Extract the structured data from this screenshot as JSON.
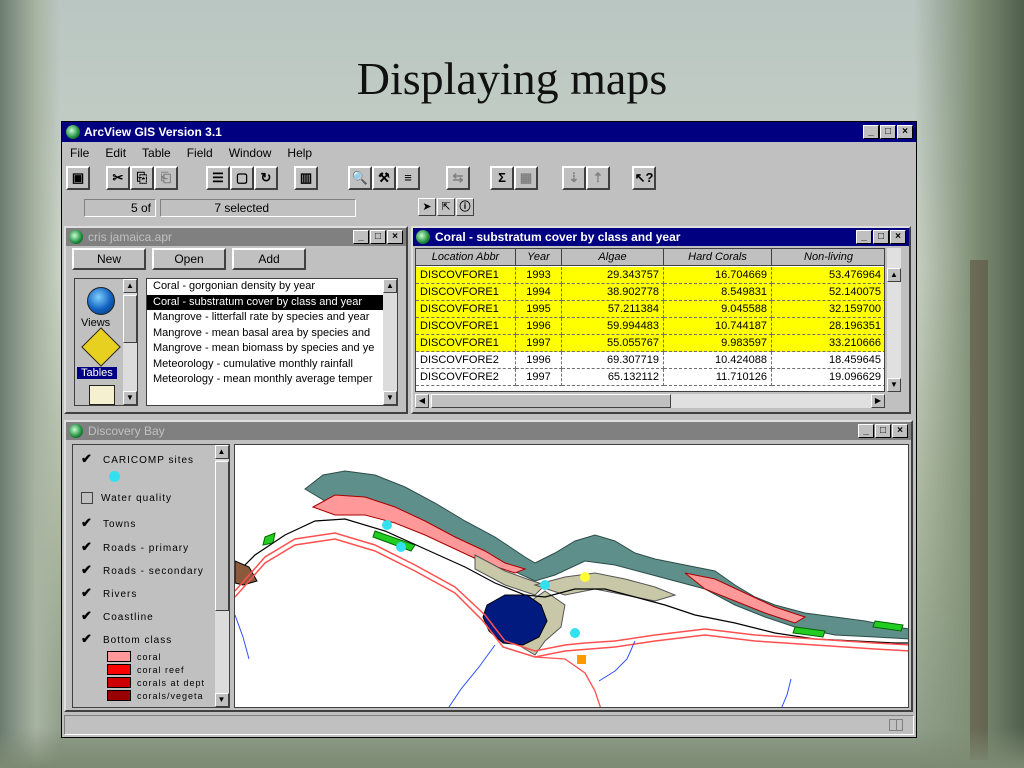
{
  "slide": {
    "title": "Displaying maps"
  },
  "app": {
    "title": "ArcView GIS Version 3.1",
    "menus": [
      "File",
      "Edit",
      "Table",
      "Field",
      "Window",
      "Help"
    ],
    "selection": {
      "count": "5",
      "of_label": "of",
      "total": "7",
      "selected_label": "selected"
    }
  },
  "project": {
    "title": "cris jamaica.apr",
    "buttons": {
      "new": "New",
      "open": "Open",
      "add": "Add"
    },
    "icon_labels": {
      "views": "Views",
      "tables": "Tables"
    },
    "documents": [
      "Coral - gorgonian density by year",
      "Coral - substratum cover by class and year",
      "Mangrove - litterfall rate by species and year",
      "Mangrove - mean basal area by species and",
      "Mangrove - mean biomass by species and ye",
      "Meteorology - cumulative monthly rainfall",
      "Meteorology - mean monthly average temper"
    ],
    "selected_document": 1
  },
  "table": {
    "title": "Coral - substratum cover by class and year",
    "columns": [
      "Location Abbr",
      "Year",
      "Algae",
      "Hard Corals",
      "Non-living"
    ],
    "rows": [
      [
        "DISCOVFORE1",
        "1993",
        "29.343757",
        "16.704669",
        "53.476964"
      ],
      [
        "DISCOVFORE1",
        "1994",
        "38.902778",
        "8.549831",
        "52.140075"
      ],
      [
        "DISCOVFORE1",
        "1995",
        "57.211384",
        "9.045588",
        "32.159700"
      ],
      [
        "DISCOVFORE1",
        "1996",
        "59.994483",
        "10.744187",
        "28.196351"
      ],
      [
        "DISCOVFORE1",
        "1997",
        "55.055767",
        "9.983597",
        "33.210666"
      ],
      [
        "DISCOVFORE2",
        "1996",
        "69.307719",
        "10.424088",
        "18.459645"
      ],
      [
        "DISCOVFORE2",
        "1997",
        "65.132112",
        "11.710126",
        "19.096629"
      ]
    ],
    "highlight_color": "#ffff00",
    "highlighted_rows": 5
  },
  "map": {
    "title": "Discovery Bay",
    "layers": [
      {
        "label": "CARICOMP sites",
        "checked": true
      },
      {
        "label": "Water quality",
        "checked": false
      },
      {
        "label": "Towns",
        "checked": true
      },
      {
        "label": "Roads - primary",
        "checked": true
      },
      {
        "label": "Roads - secondary",
        "checked": true
      },
      {
        "label": "Rivers",
        "checked": true
      },
      {
        "label": "Coastline",
        "checked": true
      },
      {
        "label": "Bottom class",
        "checked": true
      }
    ],
    "bottom_classes": [
      {
        "label": "coral",
        "color": "#ff9999"
      },
      {
        "label": "coral reef",
        "color": "#ff0000"
      },
      {
        "label": "corals at dept",
        "color": "#cc0000"
      },
      {
        "label": "corals/vegeta",
        "color": "#990000"
      }
    ],
    "colors": {
      "site": "#33e0f0",
      "reef_slope": "#5f8f8a",
      "sand": "#c8c8a8",
      "deep_water": "#001a80",
      "road": "#ff5050",
      "river": "#3050ff"
    }
  }
}
